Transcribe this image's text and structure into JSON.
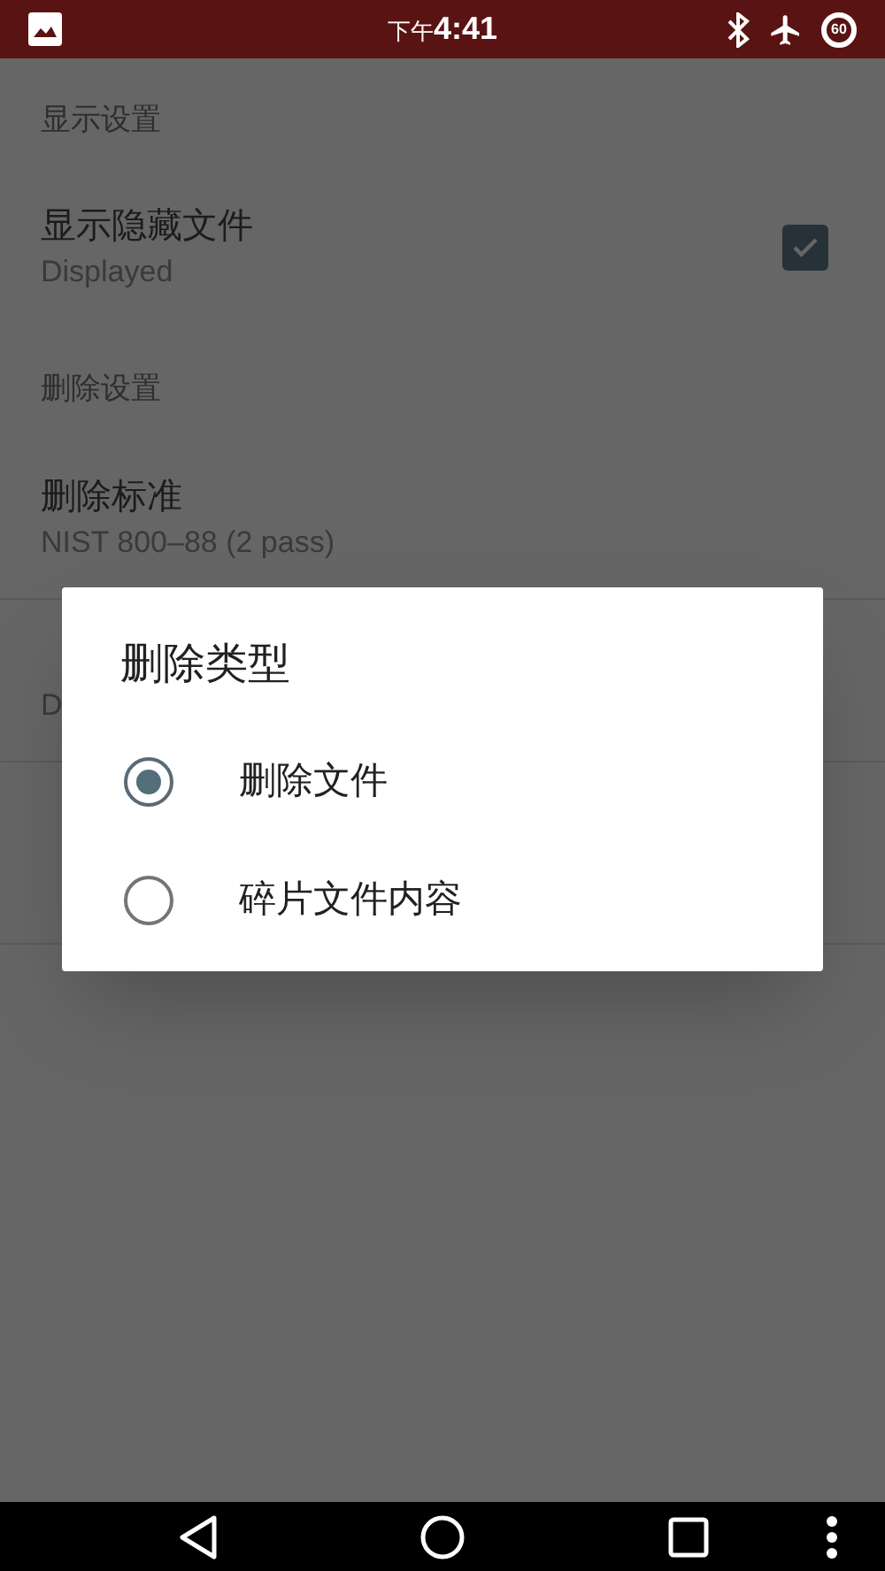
{
  "status_bar": {
    "time_prefix": "下午",
    "time": "4:41",
    "battery": "60"
  },
  "settings": [
    {
      "kind": "header",
      "title": "显示设置"
    },
    {
      "kind": "checkbox",
      "title": "显示隐藏文件",
      "summary": "Displayed",
      "checked": true
    },
    {
      "kind": "header",
      "title": "删除设置"
    },
    {
      "kind": "text",
      "title": "删除标准",
      "summary": "NIST 800–88 (2 pass)"
    },
    {
      "kind": "text",
      "summary": "D"
    }
  ],
  "dialog": {
    "title": "删除类型",
    "options": [
      {
        "label": "删除文件",
        "selected": true
      },
      {
        "label": "碎片文件内容",
        "selected": false
      }
    ]
  }
}
